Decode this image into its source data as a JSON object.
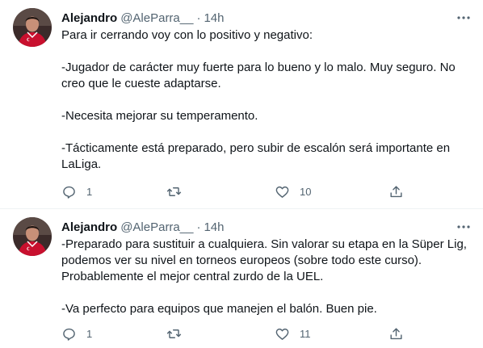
{
  "tweets": [
    {
      "author_name": "Alejandro",
      "handle": "@AleParra__",
      "separator": "·",
      "time": "14h",
      "paragraphs": [
        "Para ir cerrando voy con lo positivo y negativo:",
        "-Jugador de carácter muy fuerte para lo bueno y lo malo. Muy seguro. No creo que le cueste adaptarse.",
        "-Necesita mejorar su temperamento.",
        "-Tácticamente está preparado, pero subir de escalón será importante en LaLiga."
      ],
      "replies": "1",
      "retweets": "",
      "likes": "10"
    },
    {
      "author_name": "Alejandro",
      "handle": "@AleParra__",
      "separator": "·",
      "time": "14h",
      "paragraphs": [
        "-Preparado para sustituir a cualquiera. Sin valorar su etapa en la Süper Lig, podemos ver su nivel en torneos europeos (sobre todo este curso). Probablemente el mejor central zurdo de la UEL.",
        "-Va perfecto para equipos que manejen el balón. Buen pie."
      ],
      "replies": "1",
      "retweets": "",
      "likes": "11"
    }
  ],
  "icons": {
    "more": "more-horizontal-icon",
    "reply": "reply-icon",
    "retweet": "retweet-icon",
    "like": "like-icon",
    "share": "share-icon"
  },
  "colors": {
    "text": "#0f1419",
    "secondary": "#536471",
    "divider": "#eff3f4"
  }
}
